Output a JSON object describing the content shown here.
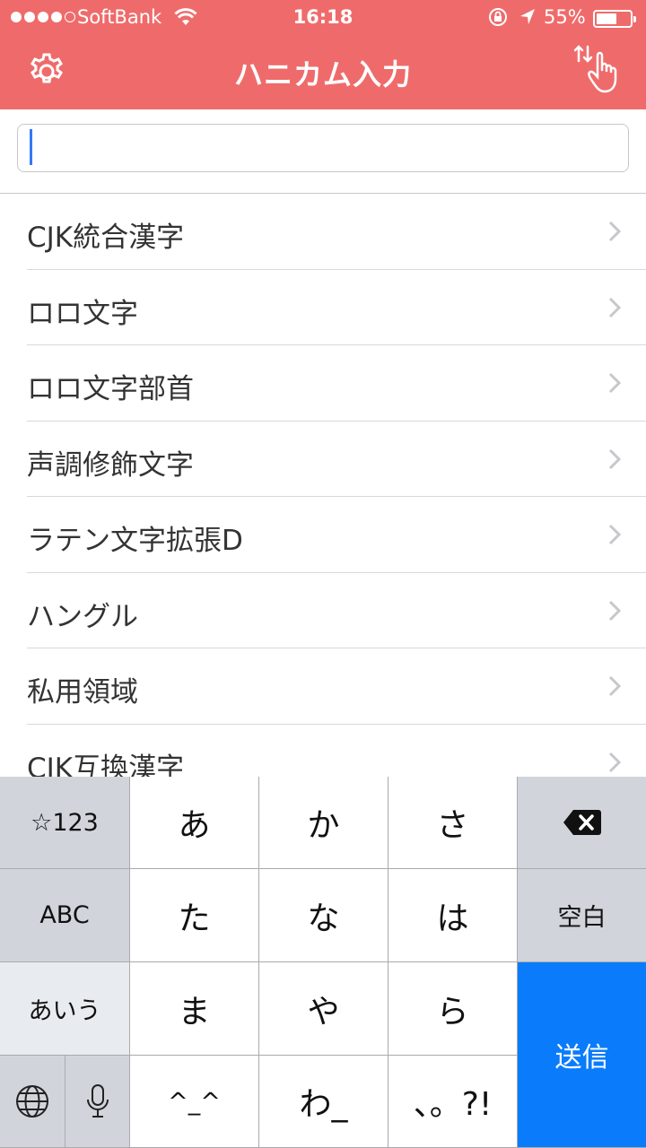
{
  "status_bar": {
    "carrier": "SoftBank",
    "time": "16:18",
    "battery_percent": "55%",
    "battery_level": 0.55,
    "signal_bars": 4,
    "icons": [
      "wifi-icon",
      "rotation-lock-icon",
      "location-arrow-icon",
      "battery-icon"
    ]
  },
  "nav": {
    "title": "ハニカム入力",
    "left_icon": "gear-icon",
    "right_icon": "swap-gesture-icon"
  },
  "search": {
    "value": "",
    "placeholder": ""
  },
  "list": {
    "items": [
      {
        "label": "CJK統合漢字"
      },
      {
        "label": "ロロ文字"
      },
      {
        "label": "ロロ文字部首"
      },
      {
        "label": "声調修飾文字"
      },
      {
        "label": "ラテン文字拡張D"
      },
      {
        "label": "ハングル"
      },
      {
        "label": "私用領域"
      },
      {
        "label": "CJK互換漢字"
      }
    ]
  },
  "keyboard": {
    "mode_symbols": "☆123",
    "mode_abc": "ABC",
    "mode_kana": "あいう",
    "keys": [
      "あ",
      "か",
      "さ",
      "た",
      "な",
      "は",
      "ま",
      "や",
      "ら",
      "^_^",
      "わ_",
      "、。?!"
    ],
    "space_label": "空白",
    "send_label": "送信",
    "colors": {
      "accent": "#ef6b6b",
      "send": "#0a7cfb",
      "key_gray": "#d1d5db"
    }
  }
}
